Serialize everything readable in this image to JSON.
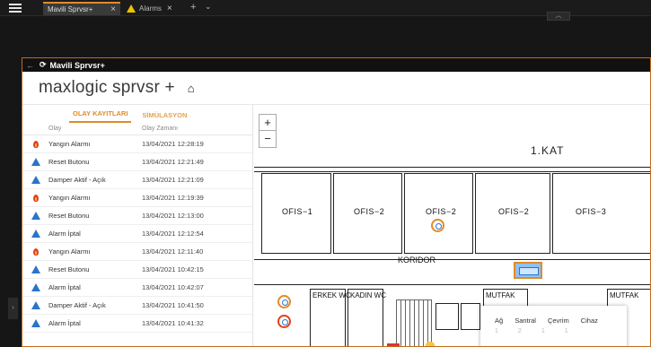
{
  "browser": {
    "tabs": [
      {
        "label": "Mavili Sprvsr+",
        "active": true
      },
      {
        "label": "Alarms",
        "active": false
      }
    ]
  },
  "app": {
    "title": "Mavili Sprvsr+",
    "brand": "maxlogic sprvsr +"
  },
  "events_panel": {
    "tabs": [
      "OLAY KAYITLARI",
      "SİMÜLASYON"
    ],
    "columns": [
      "Olay",
      "Olay Zamanı"
    ],
    "rows": [
      {
        "type": "fire",
        "name": "Yangın Alarmı",
        "time": "13/04/2021 12:28:19"
      },
      {
        "type": "info",
        "name": "Reset Butonu",
        "time": "13/04/2021 12:21:49"
      },
      {
        "type": "info",
        "name": "Damper Aktif - Açık",
        "time": "13/04/2021 12:21:09"
      },
      {
        "type": "fire",
        "name": "Yangın Alarmı",
        "time": "13/04/2021 12:19:39"
      },
      {
        "type": "info",
        "name": "Reset Butonu",
        "time": "13/04/2021 12:13:00"
      },
      {
        "type": "info",
        "name": "Alarm İptal",
        "time": "13/04/2021 12:12:54"
      },
      {
        "type": "fire",
        "name": "Yangın Alarmı",
        "time": "13/04/2021 12:11:40"
      },
      {
        "type": "info",
        "name": "Reset Butonu",
        "time": "13/04/2021 10:42:15"
      },
      {
        "type": "info",
        "name": "Alarm İptal",
        "time": "13/04/2021 10:42:07"
      },
      {
        "type": "info",
        "name": "Damper Aktif - Açık",
        "time": "13/04/2021 10:41:50"
      },
      {
        "type": "info",
        "name": "Alarm İptal",
        "time": "13/04/2021 10:41:32"
      }
    ]
  },
  "floorplan": {
    "zoom_in": "+",
    "zoom_out": "−",
    "floor_title": "1.KAT",
    "rooms": [
      "OFIS−1",
      "OFIS−2",
      "OFIS−2",
      "OFIS−2",
      "OFIS−3"
    ],
    "corridor": "KORIDOR",
    "wc": [
      "ERKEK WC",
      "KADIN WC"
    ],
    "kitchens": [
      "MUTFAK",
      "MUTFAK"
    ]
  },
  "popup": {
    "headers": [
      "Ağ",
      "Santral",
      "Çevrim",
      "Cihaz"
    ],
    "values": [
      "1",
      "2",
      "1",
      "1"
    ]
  }
}
